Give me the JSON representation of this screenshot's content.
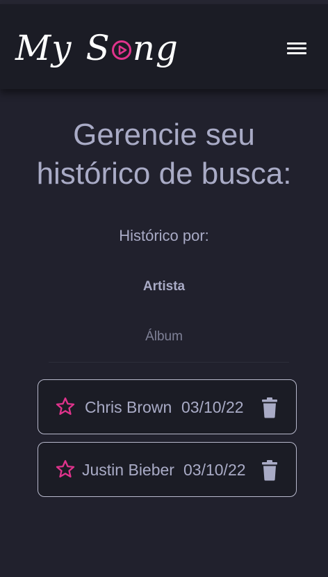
{
  "header": {
    "logo_word1": "My",
    "logo_word2_start": "S",
    "logo_word2_end": "ng",
    "menu_icon": "hamburger-menu-icon"
  },
  "main": {
    "title_line1": "Gerencie seu",
    "title_line2": "histórico de busca:",
    "history_by_label": "Histórico por:",
    "tabs": [
      {
        "label": "Artista",
        "active": true
      },
      {
        "label": "Álbum",
        "active": false
      }
    ]
  },
  "history": [
    {
      "name": "Chris Brown",
      "date": "03/10/22",
      "favorite_icon": "star-outline-icon",
      "delete_icon": "trash-icon"
    },
    {
      "name": "Justin Bieber",
      "date": "03/10/22",
      "favorite_icon": "star-outline-icon",
      "delete_icon": "trash-icon"
    }
  ],
  "colors": {
    "background": "#21212d",
    "header": "#1b1c25",
    "accent": "#e0338c",
    "text": "#a9abc6",
    "text_muted": "#7f8197",
    "card_border": "#b9bacd"
  }
}
